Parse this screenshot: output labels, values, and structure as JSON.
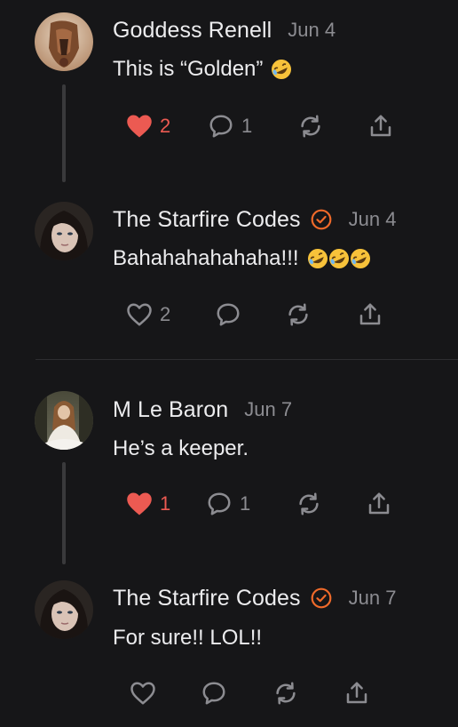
{
  "comments": [
    {
      "author": "Goddess Renell",
      "date": "Jun 4",
      "text": "This is “Golden”",
      "emoji": "rofl-emoji",
      "verified": false,
      "likes": "2",
      "liked": true,
      "replies": "1"
    },
    {
      "author": "The Starfire Codes",
      "date": "Jun 4",
      "text": "Bahahahahahaha!!!",
      "emoji": "rofl-emoji x3",
      "verified": true,
      "likes": "2",
      "liked": false,
      "replies": ""
    },
    {
      "author": "M Le Baron",
      "date": "Jun 7",
      "text": "He’s a keeper.",
      "verified": false,
      "likes": "1",
      "liked": true,
      "replies": "1"
    },
    {
      "author": "The Starfire Codes",
      "date": "Jun 7",
      "text": "For sure!! LOL!!",
      "verified": true,
      "likes": "",
      "liked": false,
      "replies": ""
    }
  ],
  "colors": {
    "background": "#161618",
    "accent": "#ec5a52",
    "verified": "#f06a2a",
    "muted": "#8c8c91"
  },
  "icons": [
    "heart-icon",
    "comment-icon",
    "restack-icon",
    "share-icon",
    "verified-badge-icon"
  ]
}
